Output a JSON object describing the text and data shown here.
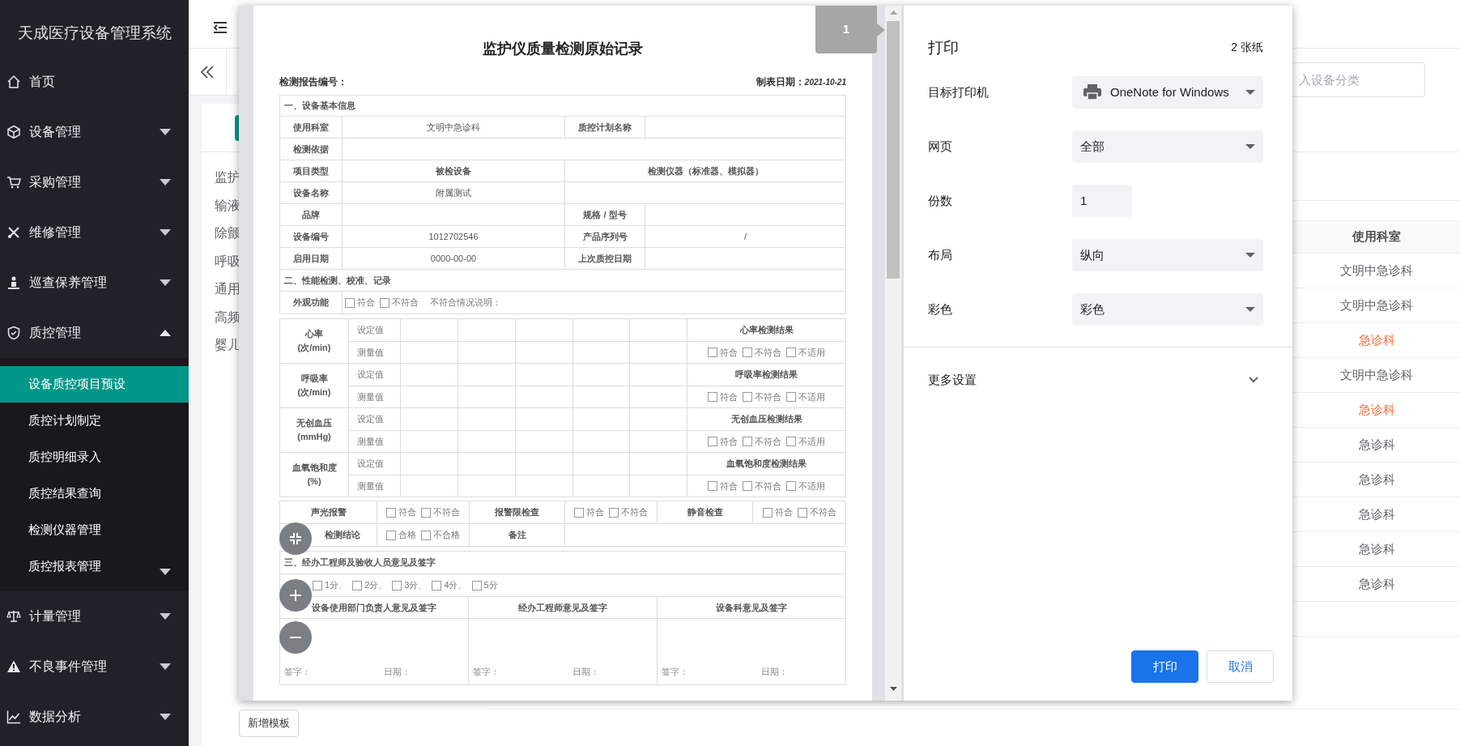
{
  "sidebar": {
    "title": "天成医疗设备管理系统",
    "items": [
      {
        "label": "首页",
        "kind": "link"
      },
      {
        "label": "设备管理",
        "kind": "group",
        "expanded": false
      },
      {
        "label": "采购管理",
        "kind": "group",
        "expanded": false
      },
      {
        "label": "维修管理",
        "kind": "group",
        "expanded": false
      },
      {
        "label": "巡查保养管理",
        "kind": "group",
        "expanded": false
      },
      {
        "label": "质控管理",
        "kind": "group",
        "expanded": true,
        "children": [
          {
            "label": "设备质控项目预设",
            "kind": "link",
            "selected": true
          },
          {
            "label": "质控计划制定",
            "kind": "link",
            "selected": false
          },
          {
            "label": "质控明细录入",
            "kind": "link",
            "selected": false
          },
          {
            "label": "质控结果查询",
            "kind": "link",
            "selected": false
          },
          {
            "label": "检测仪器管理",
            "kind": "link",
            "selected": false
          },
          {
            "label": "质控报表管理",
            "kind": "group",
            "selected": false,
            "expanded": false
          }
        ]
      },
      {
        "label": "计量管理",
        "kind": "group",
        "expanded": false
      },
      {
        "label": "不良事件管理",
        "kind": "group",
        "expanded": false
      },
      {
        "label": "数据分析",
        "kind": "group",
        "expanded": false
      }
    ]
  },
  "background": {
    "template_list": [
      "监护",
      "输液",
      "除颤",
      "呼吸",
      "通用",
      "高频",
      "婴儿"
    ],
    "add_button": "新增模板",
    "search_placeholder": "入设备分类",
    "table": {
      "column": "使用科室",
      "rows": [
        {
          "department": "文明中急诊科",
          "highlighted": false
        },
        {
          "department": "文明中急诊科",
          "highlighted": false
        },
        {
          "department": "急诊科",
          "highlighted": true
        },
        {
          "department": "文明中急诊科",
          "highlighted": false
        },
        {
          "department": "急诊科",
          "highlighted": true
        },
        {
          "department": "急诊科",
          "highlighted": false
        },
        {
          "department": "急诊科",
          "highlighted": false
        },
        {
          "department": "急诊科",
          "highlighted": false
        },
        {
          "department": "急诊科",
          "highlighted": false
        },
        {
          "department": "急诊科",
          "highlighted": false
        }
      ]
    }
  },
  "print_dialog": {
    "page_tab": "1",
    "title": "打印",
    "sheet_count": "2 张纸",
    "settings": [
      {
        "label": "目标打印机",
        "kind": "printer",
        "value": "OneNote for Windows"
      },
      {
        "label": "网页",
        "kind": "select",
        "value": "全部"
      },
      {
        "label": "份数",
        "kind": "number",
        "value": "1"
      },
      {
        "label": "布局",
        "kind": "select",
        "value": "纵向"
      },
      {
        "label": "彩色",
        "kind": "select",
        "value": "彩色"
      }
    ],
    "more_settings": {
      "label": "更多设置",
      "expanded": false
    },
    "buttons": [
      {
        "label": "打印",
        "kind": "primary"
      },
      {
        "label": "取消",
        "kind": "secondary"
      }
    ]
  },
  "document": {
    "title": "监护仪质量检测原始记录",
    "report_no_label": "检测报告编号：",
    "date_label": "制表日期：",
    "date": "2021-10-21",
    "sections": [
      "一、设备基本信息",
      "二、性能检测、校准、记录",
      "三、经办工程师及验收人员意见及签字"
    ],
    "info_rows": [
      {
        "kind": "quad",
        "label": "使用科室",
        "value": "文明中急诊科",
        "label2": "质控计划名称"
      },
      {
        "kind": "wide",
        "label": "检测依据"
      },
      {
        "kind": "heading",
        "label": "项目类型",
        "value": "被检设备",
        "value2": "检测仪器（标准器、模拟器）"
      },
      {
        "kind": "split",
        "label": "设备名称",
        "value": "附属测试"
      },
      {
        "kind": "quad",
        "label": "品牌",
        "label2": "规格 / 型号"
      },
      {
        "kind": "quad",
        "label": "设备编号",
        "value": "1012702546",
        "label2": "产品序列号",
        "value2": "/"
      },
      {
        "kind": "quad",
        "label": "启用日期",
        "value": "0000-00-00",
        "label2": "上次质控日期"
      }
    ],
    "appearance": {
      "label": "外观功能",
      "options": [
        {
          "label": "符合",
          "checked": false
        },
        {
          "label": "不符合",
          "checked": false
        }
      ],
      "note": "不符合情况说明："
    },
    "measurements": [
      {
        "name": "心率",
        "unit": "(次/min)",
        "set_label": "设定值",
        "measured_label": "测量值",
        "result_title": "心率检测结果",
        "options": [
          {
            "label": "符合",
            "checked": false
          },
          {
            "label": "不符合",
            "checked": false
          },
          {
            "label": "不适用",
            "checked": false
          }
        ]
      },
      {
        "name": "呼吸率",
        "unit": "(次/min)",
        "set_label": "设定值",
        "measured_label": "测量值",
        "result_title": "呼吸率检测结果",
        "options": [
          {
            "label": "符合",
            "checked": false
          },
          {
            "label": "不符合",
            "checked": false
          },
          {
            "label": "不适用",
            "checked": false
          }
        ]
      },
      {
        "name": "无创血压",
        "unit": "(mmHg)",
        "set_label": "设定值",
        "measured_label": "测量值",
        "result_title": "无创血压检测结果",
        "options": [
          {
            "label": "符合",
            "checked": false
          },
          {
            "label": "不符合",
            "checked": false
          },
          {
            "label": "不适用",
            "checked": false
          }
        ]
      },
      {
        "name": "血氧饱和度",
        "unit": "(%)",
        "set_label": "设定值",
        "measured_label": "测量值",
        "result_title": "血氧饱和度检测结果",
        "options": [
          {
            "label": "符合",
            "checked": false
          },
          {
            "label": "不符合",
            "checked": false
          },
          {
            "label": "不适用",
            "checked": false
          }
        ]
      }
    ],
    "checks": [
      {
        "label": "声光报警",
        "options": [
          {
            "label": "符合",
            "checked": false
          },
          {
            "label": "不符合",
            "checked": false
          }
        ]
      },
      {
        "label": "报警限检查",
        "options": [
          {
            "label": "符合",
            "checked": false
          },
          {
            "label": "不符合",
            "checked": false
          }
        ]
      },
      {
        "label": "静音检查",
        "options": [
          {
            "label": "符合",
            "checked": false
          },
          {
            "label": "不符合",
            "checked": false
          }
        ]
      }
    ],
    "conclusion": {
      "label": "检测结论",
      "options": [
        {
          "label": "合格",
          "checked": false
        },
        {
          "label": "不合格",
          "checked": false
        }
      ]
    },
    "remark_label": "备注",
    "rating_options": [
      {
        "label": "1分、",
        "checked": false
      },
      {
        "label": "2分、",
        "checked": false
      },
      {
        "label": "3分、",
        "checked": false
      },
      {
        "label": "4分、",
        "checked": false
      },
      {
        "label": "5分",
        "checked": false
      }
    ],
    "signatures": [
      {
        "title": "设备使用部门负责人意见及签字",
        "sign_label": "签字：",
        "date_label": "日期："
      },
      {
        "title": "经办工程师意见及签字",
        "sign_label": "签字：",
        "date_label": "日期："
      },
      {
        "title": "设备科意见及签字",
        "sign_label": "签字：",
        "date_label": "日期："
      }
    ]
  }
}
